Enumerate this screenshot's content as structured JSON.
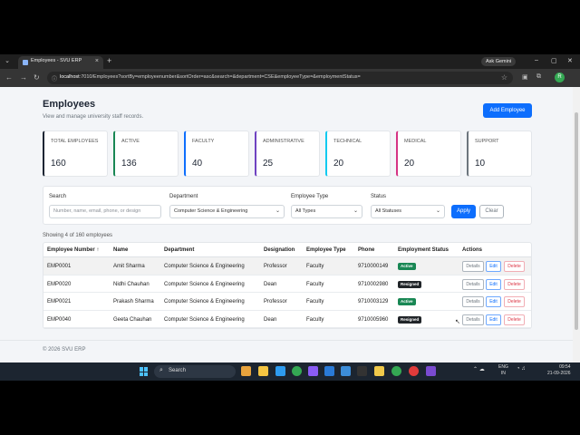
{
  "browser": {
    "tab_title": "Employees - SVU ERP",
    "ask_gemini": "Ask Gemini",
    "url_host": "localhost",
    "url_rest": ":7010/Employees?sortBy=employeenumber&sortOrder=asc&search=&department=CSE&employeeType=&employmentStatus=",
    "profile_initial": "R"
  },
  "page": {
    "title": "Employees",
    "subtitle": "View and manage university staff records.",
    "add_button": "Add Employee"
  },
  "cards": [
    {
      "label": "TOTAL EMPLOYEES",
      "value": "160",
      "color": "#1d2533"
    },
    {
      "label": "ACTIVE",
      "value": "136",
      "color": "#198754"
    },
    {
      "label": "FACULTY",
      "value": "40",
      "color": "#0d6efd"
    },
    {
      "label": "ADMINISTRATIVE",
      "value": "25",
      "color": "#6f42c1"
    },
    {
      "label": "TECHNICAL",
      "value": "20",
      "color": "#0dcaf0"
    },
    {
      "label": "MEDICAL",
      "value": "20",
      "color": "#d63384"
    },
    {
      "label": "SUPPORT",
      "value": "10",
      "color": "#6c757d"
    }
  ],
  "filters": {
    "search_label": "Search",
    "search_placeholder": "Number, name, email, phone, or design",
    "department_label": "Department",
    "department_value": "Computer Science & Engineering",
    "type_label": "Employee Type",
    "type_value": "All Types",
    "status_label": "Status",
    "status_value": "All Statuses",
    "apply": "Apply",
    "clear": "Clear"
  },
  "showing": "Showing 4 of 160 employees",
  "table": {
    "headers": [
      "Employee Number ↑",
      "Name",
      "Department",
      "Designation",
      "Employee Type",
      "Phone",
      "Employment Status",
      "Actions"
    ],
    "rows": [
      {
        "number": "EMP0001",
        "name": "Amit Sharma",
        "department": "Computer Science & Engineering",
        "designation": "Professor",
        "type": "Faculty",
        "phone": "9710000149",
        "status": "Active",
        "status_color": "#198754"
      },
      {
        "number": "EMP0020",
        "name": "Nidhi Chauhan",
        "department": "Computer Science & Engineering",
        "designation": "Dean",
        "type": "Faculty",
        "phone": "9710002980",
        "status": "Resigned",
        "status_color": "#212529"
      },
      {
        "number": "EMP0021",
        "name": "Prakash Sharma",
        "department": "Computer Science & Engineering",
        "designation": "Professor",
        "type": "Faculty",
        "phone": "9710003129",
        "status": "Active",
        "status_color": "#198754"
      },
      {
        "number": "EMP0040",
        "name": "Geeta Chauhan",
        "department": "Computer Science & Engineering",
        "designation": "Dean",
        "type": "Faculty",
        "phone": "9710005960",
        "status": "Resigned",
        "status_color": "#212529"
      }
    ],
    "actions": {
      "details": "Details",
      "edit": "Edit",
      "delete": "Delete"
    }
  },
  "footer": "© 2026 SVU ERP",
  "taskbar": {
    "search": "Search",
    "lang_line1": "ENG",
    "lang_line2": "IN",
    "time": "09:54",
    "date": "21-09-2026"
  }
}
